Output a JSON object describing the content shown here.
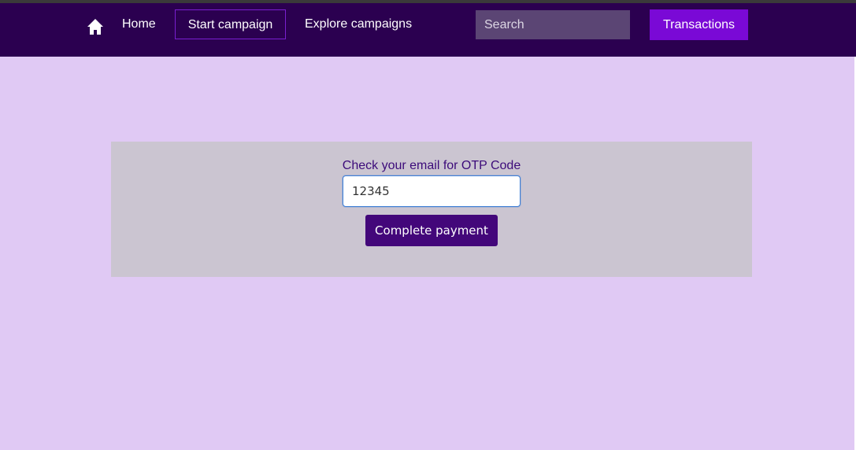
{
  "nav": {
    "home_icon": "home-icon",
    "home_label": "Home",
    "start_campaign_label": "Start campaign",
    "explore_label": "Explore campaigns",
    "search_placeholder": "Search",
    "transactions_label": "Transactions"
  },
  "otp": {
    "prompt": "Check your email for OTP Code",
    "value": "12345",
    "submit_label": "Complete payment"
  },
  "colors": {
    "navbar": "#2b0050",
    "page_background": "#e0c9f4",
    "panel": "#cbc5d1",
    "accent": "#7a09d6",
    "button": "#43077a",
    "label_text": "#3c0b7a"
  }
}
